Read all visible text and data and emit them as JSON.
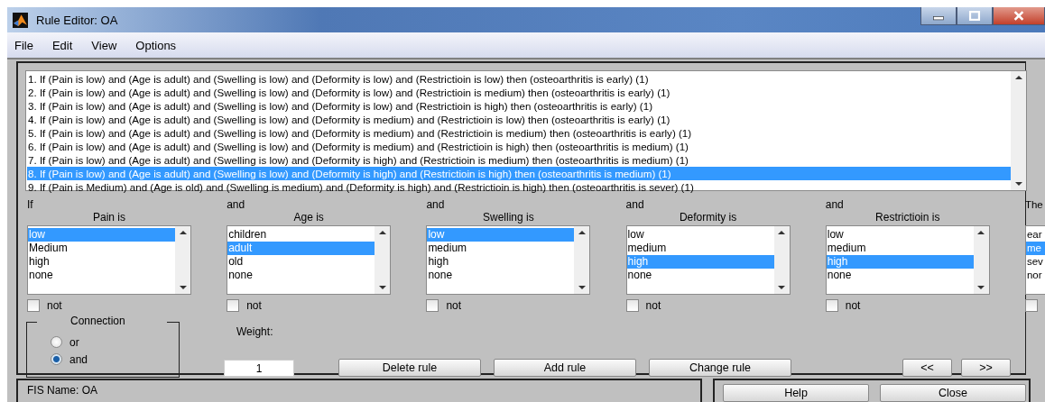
{
  "window": {
    "title": "Rule Editor: OA"
  },
  "menu": [
    "File",
    "Edit",
    "View",
    "Options"
  ],
  "rules": [
    {
      "text": "1. If (Pain is low) and (Age is adult) and (Swelling is low) and (Deformity is low) and (Restrictioin is low) then (osteoarthritis is early) (1)",
      "selected": false
    },
    {
      "text": "2. If (Pain is low) and (Age is adult) and (Swelling is low) and (Deformity is low) and (Restrictioin is medium) then (osteoarthritis is early) (1)",
      "selected": false
    },
    {
      "text": "3. If (Pain is low) and (Age is adult) and (Swelling is low) and (Deformity is low) and (Restrictioin is high) then (osteoarthritis is early) (1)",
      "selected": false
    },
    {
      "text": "4. If (Pain is low) and (Age is adult) and (Swelling is low) and (Deformity is medium) and (Restrictioin is low) then (osteoarthritis is early) (1)",
      "selected": false
    },
    {
      "text": "5. If (Pain is low) and (Age is adult) and (Swelling is low) and (Deformity is medium) and (Restrictioin is medium) then (osteoarthritis is early) (1)",
      "selected": false
    },
    {
      "text": "6. If (Pain is low) and (Age is adult) and (Swelling is low) and (Deformity is medium) and (Restrictioin is high) then (osteoarthritis is medium) (1)",
      "selected": false
    },
    {
      "text": "7. If (Pain is low) and (Age is adult) and (Swelling is low) and (Deformity is high) and (Restrictioin is medium) then (osteoarthritis is medium) (1)",
      "selected": false
    },
    {
      "text": "8. If (Pain is low) and (Age is adult) and (Swelling is low) and (Deformity is high) and (Restrictioin is high) then (osteoarthritis is medium) (1)",
      "selected": true
    },
    {
      "text": "9. If (Pain is Medium) and (Age is old) and (Swelling is medium) and (Deformity is high) and (Restrictioin is high) then (osteoarthritis is sever) (1)",
      "selected": false
    }
  ],
  "variables": [
    {
      "connector": "If",
      "label": "Pain is",
      "items": [
        {
          "label": "low",
          "selected": true
        },
        {
          "label": "Medium",
          "selected": false
        },
        {
          "label": "high",
          "selected": false
        },
        {
          "label": "none",
          "selected": false
        }
      ],
      "not_label": "not",
      "not_checked": false
    },
    {
      "connector": "and",
      "label": "Age is",
      "items": [
        {
          "label": "children",
          "selected": false
        },
        {
          "label": "adult",
          "selected": true
        },
        {
          "label": "old",
          "selected": false
        },
        {
          "label": "none",
          "selected": false
        }
      ],
      "not_label": "not",
      "not_checked": false
    },
    {
      "connector": "and",
      "label": "Swelling is",
      "items": [
        {
          "label": "low",
          "selected": true
        },
        {
          "label": "medium",
          "selected": false
        },
        {
          "label": "high",
          "selected": false
        },
        {
          "label": "none",
          "selected": false
        }
      ],
      "not_label": "not",
      "not_checked": false
    },
    {
      "connector": "and",
      "label": "Deformity is",
      "items": [
        {
          "label": "low",
          "selected": false
        },
        {
          "label": "medium",
          "selected": false
        },
        {
          "label": "high",
          "selected": true
        },
        {
          "label": "none",
          "selected": false
        }
      ],
      "not_label": "not",
      "not_checked": false
    },
    {
      "connector": "and",
      "label": "Restrictioin is",
      "items": [
        {
          "label": "low",
          "selected": false
        },
        {
          "label": "medium",
          "selected": false
        },
        {
          "label": "high",
          "selected": true
        },
        {
          "label": "none",
          "selected": false
        }
      ],
      "not_label": "not",
      "not_checked": false
    },
    {
      "connector": "The",
      "items": [
        {
          "label": "ear",
          "selected": false
        },
        {
          "label": "me",
          "selected": true
        },
        {
          "label": "sev",
          "selected": false
        },
        {
          "label": "nor",
          "selected": false
        }
      ],
      "not_checked": false
    }
  ],
  "connection": {
    "title": "Connection",
    "options": [
      {
        "label": "or",
        "selected": false
      },
      {
        "label": "and",
        "selected": true
      }
    ]
  },
  "weight": {
    "label": "Weight:",
    "value": "1"
  },
  "rule_buttons": [
    "Delete rule",
    "Add rule",
    "Change rule"
  ],
  "nav_buttons": [
    "<<",
    ">>"
  ],
  "status": "FIS Name: OA",
  "footer_buttons": [
    "Help",
    "Close"
  ]
}
